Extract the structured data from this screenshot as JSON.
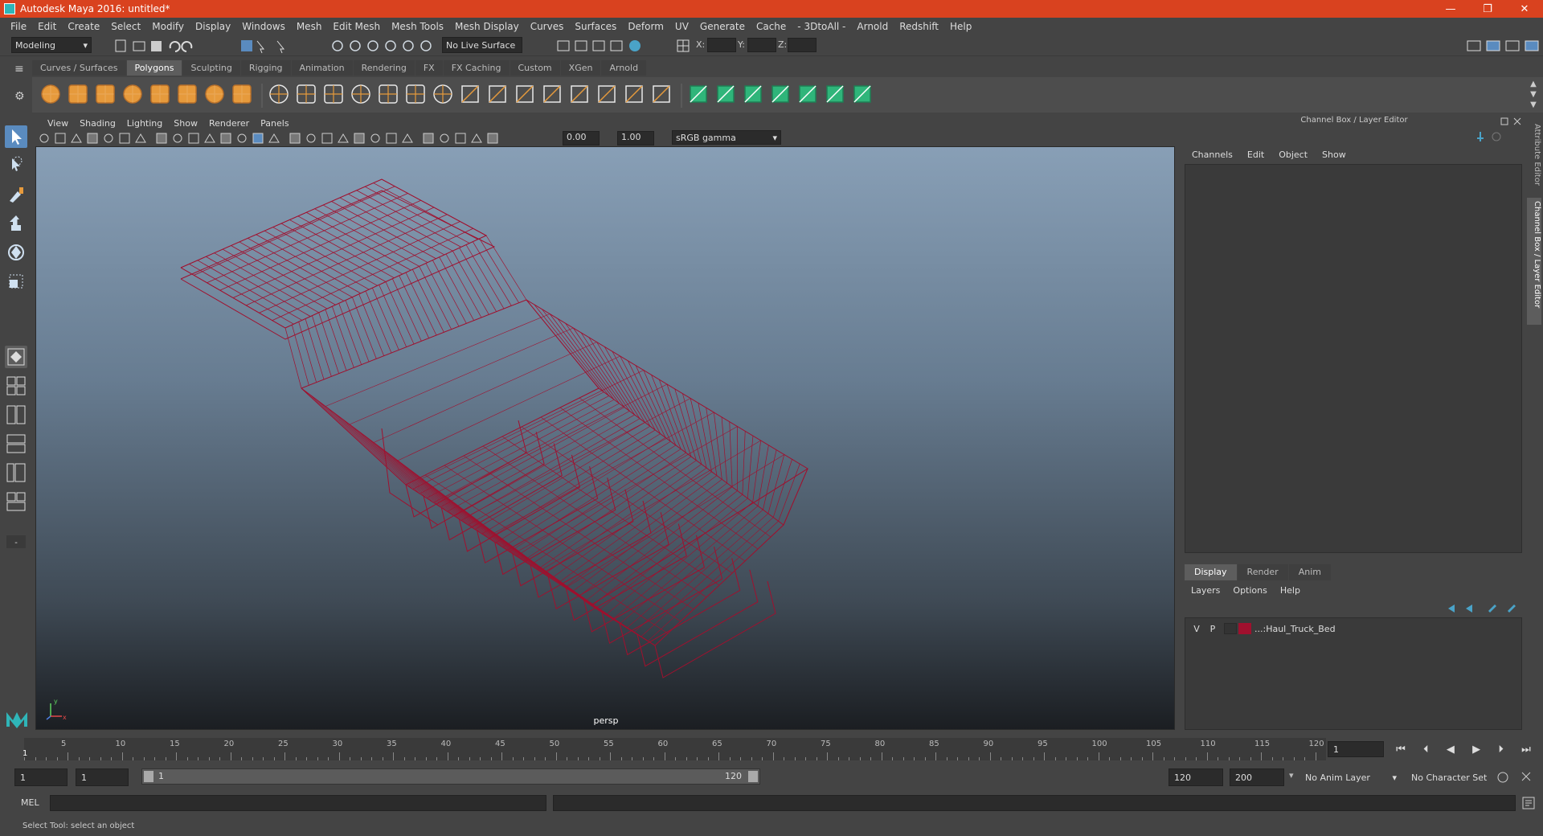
{
  "window": {
    "title": "Autodesk Maya 2016: untitled*",
    "minimize": "—",
    "maximize": "❐",
    "close": "✕"
  },
  "menubar": [
    "File",
    "Edit",
    "Create",
    "Select",
    "Modify",
    "Display",
    "Windows",
    "Mesh",
    "Edit Mesh",
    "Mesh Tools",
    "Mesh Display",
    "Curves",
    "Surfaces",
    "Deform",
    "UV",
    "Generate",
    "Cache",
    "- 3DtoAll -",
    "Arnold",
    "Redshift",
    "Help"
  ],
  "statusline": {
    "mode": "Modeling",
    "live_surface": "No Live Surface",
    "x_label": "X:",
    "y_label": "Y:",
    "z_label": "Z:"
  },
  "shelf_tabs": [
    "Curves / Surfaces",
    "Polygons",
    "Sculpting",
    "Rigging",
    "Animation",
    "Rendering",
    "FX",
    "FX Caching",
    "Custom",
    "XGen",
    "Arnold"
  ],
  "shelf_active": "Polygons",
  "viewport": {
    "menu": [
      "View",
      "Shading",
      "Lighting",
      "Show",
      "Renderer",
      "Panels"
    ],
    "exposure": "0.00",
    "gamma": "1.00",
    "color_space": "sRGB gamma",
    "camera_label": "persp",
    "axis_x": "x",
    "axis_y": "y"
  },
  "right_panel": {
    "title": "Channel Box / Layer Editor",
    "menu": [
      "Channels",
      "Edit",
      "Object",
      "Show"
    ],
    "layer_tabs": [
      "Display",
      "Render",
      "Anim"
    ],
    "layer_active": "Display",
    "layer_menu": [
      "Layers",
      "Options",
      "Help"
    ],
    "layers": [
      {
        "v": "V",
        "p": "P",
        "name": "...:Haul_Truck_Bed",
        "color": "#a0102e"
      }
    ],
    "side_tabs": [
      "Attribute Editor",
      "Channel Box / Layer Editor"
    ]
  },
  "timeline": {
    "ticks": [
      "5",
      "10",
      "15",
      "20",
      "25",
      "30",
      "35",
      "40",
      "45",
      "50",
      "55",
      "60",
      "65",
      "70",
      "75",
      "80",
      "85",
      "90",
      "95",
      "100",
      "105",
      "110",
      "115",
      "120"
    ],
    "start_marker": "1",
    "current_frame": "1",
    "playback_icons": [
      "⏮",
      "⏴",
      "◀",
      "▶",
      "⏵",
      "⏭"
    ]
  },
  "range": {
    "start": "1",
    "playback_start": "1",
    "slider_start": "1",
    "slider_end": "120",
    "playback_end": "120",
    "end": "200",
    "anim_layer": "No Anim Layer",
    "char_set": "No Character Set"
  },
  "command": {
    "label": "MEL",
    "help": "Select Tool: select an object"
  },
  "colors": {
    "title_bar": "#d9421f",
    "wire": "#a0102e",
    "shelf_icon": "#e69a3c",
    "accent": "#5a8bbf"
  }
}
